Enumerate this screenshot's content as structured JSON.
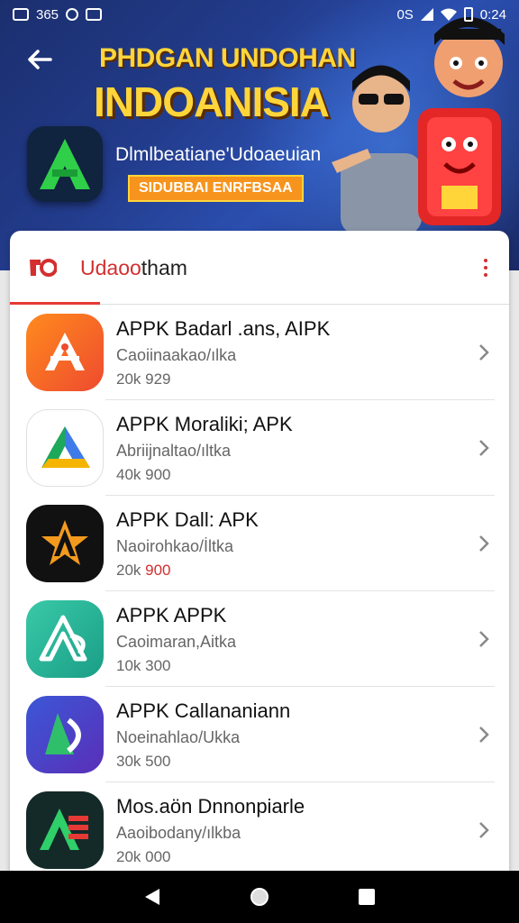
{
  "status_bar": {
    "left_text": "365",
    "right_text": "0S",
    "time": "0:24"
  },
  "banner": {
    "title_line1": "PHDGAN UNDOHAN",
    "title_line2": "INDOANISIA",
    "subtitle": "Dlmlbeatiane'Udoaeuian",
    "tag": "SIDUBBAI ENRFBSAA",
    "colors": {
      "title": "#ffd53a",
      "tag_bg": "#f7941d"
    }
  },
  "card": {
    "title_main": "Udaoo",
    "title_rest": "tham",
    "accent": "#d32f2f"
  },
  "apps": [
    {
      "name": "APPK Badarl  .ans, AIPK",
      "desc": "Caoiinaakao/ılka",
      "size": "20k 929",
      "size_red": "",
      "icon": "android-app-store-icon"
    },
    {
      "name": "APPK Moraliki; APK",
      "desc": "Abriijnaltao/ıltka",
      "size": "40k 900",
      "size_red": "",
      "icon": "drive-triangle-icon"
    },
    {
      "name": "APPK Dall: APK",
      "desc": "Naoirohkao/İltka",
      "size": "20k ",
      "size_red": "900",
      "icon": "star-a-icon"
    },
    {
      "name": "APPK APPK",
      "desc": "Caoimaran,Aitka",
      "size": "10k 300",
      "size_red": "",
      "icon": "teal-a-icon"
    },
    {
      "name": "APPK Callananiann",
      "desc": "Noeinahlao/Ukka",
      "size": "30k 500",
      "size_red": "",
      "icon": "blue-d-icon"
    },
    {
      "name": "Mos.aön Dnnonpiarle",
      "desc": "Aaoibodany/ılkba",
      "size": "20k 000",
      "size_red": "",
      "icon": "dark-a-icon"
    }
  ]
}
